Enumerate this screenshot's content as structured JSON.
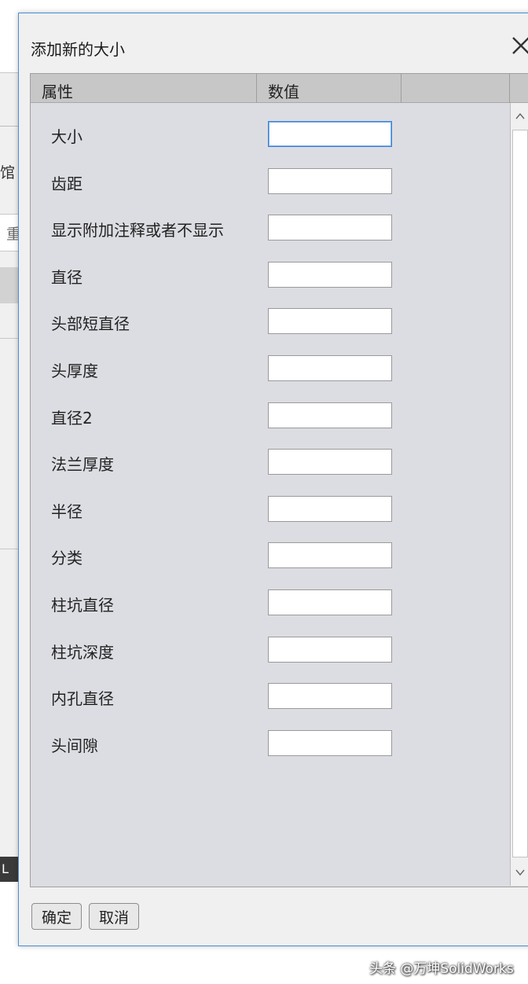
{
  "background": {
    "fragment_text_1": "馆",
    "fragment_text_2": "重",
    "fragment_text_3": "L"
  },
  "dialog": {
    "title": "添加新的大小",
    "columns": {
      "property": "属性",
      "value": "数值"
    },
    "rows": [
      {
        "label": "大小",
        "value": ""
      },
      {
        "label": "齿距",
        "value": ""
      },
      {
        "label": "显示附加注释或者不显示",
        "value": ""
      },
      {
        "label": "直径",
        "value": ""
      },
      {
        "label": "头部短直径",
        "value": ""
      },
      {
        "label": "头厚度",
        "value": ""
      },
      {
        "label": "直径2",
        "value": ""
      },
      {
        "label": "法兰厚度",
        "value": ""
      },
      {
        "label": "半径",
        "value": ""
      },
      {
        "label": "分类",
        "value": ""
      },
      {
        "label": "柱坑直径",
        "value": ""
      },
      {
        "label": "柱坑深度",
        "value": ""
      },
      {
        "label": "内孔直径",
        "value": ""
      },
      {
        "label": "头间隙",
        "value": ""
      }
    ],
    "buttons": {
      "ok": "确定",
      "cancel": "取消"
    },
    "focused_row": 0
  },
  "watermark": "头条 @万坤SolidWorks",
  "colors": {
    "accent": "#4a90d9",
    "panel": "#dcdde2",
    "header": "#c7c7c7"
  }
}
